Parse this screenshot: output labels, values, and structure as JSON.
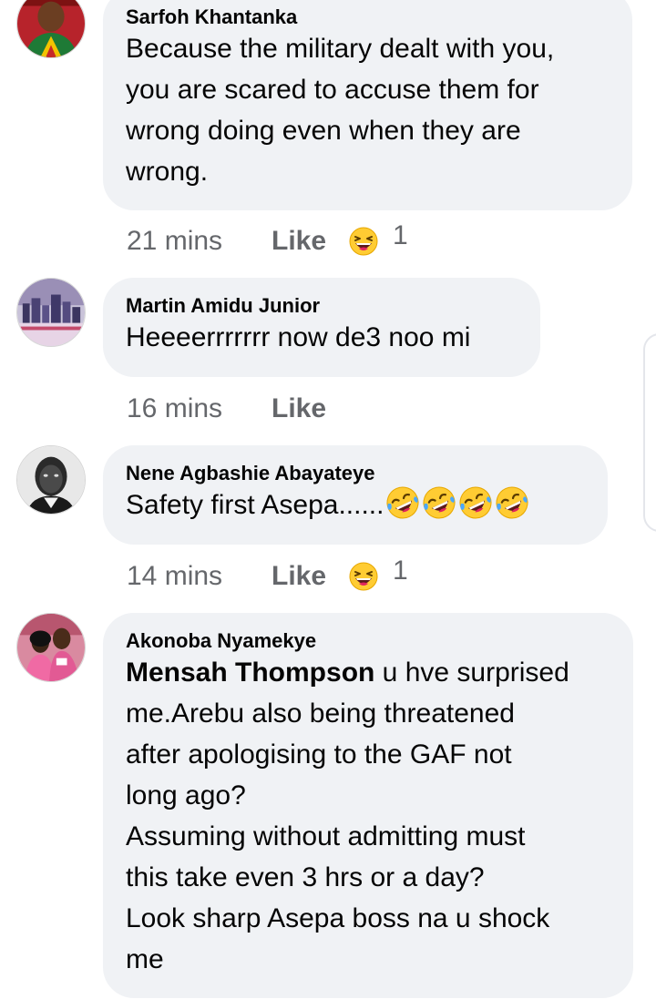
{
  "comments": [
    {
      "author": "Sarfoh Khantanka",
      "lines": [
        "Because the military dealt with you,",
        "you are scared to accuse them for",
        "wrong doing even when they are",
        "wrong."
      ],
      "time": "21 mins",
      "like_label": "Like",
      "reaction_icon": "laughing-face",
      "reaction_count": "1"
    },
    {
      "author": "Martin Amidu Junior",
      "lines": [
        "Heeeerrrrrrr now de3 noo mi"
      ],
      "time": "16 mins",
      "like_label": "Like"
    },
    {
      "author": "Nene Agbashie Abayateye",
      "lines": [
        "Safety first Asepa......"
      ],
      "inline_emoji": [
        "rolling-on-floor-laughing",
        "rolling-on-floor-laughing",
        "rolling-on-floor-laughing",
        "rolling-on-floor-laughing"
      ],
      "time": "14 mins",
      "like_label": "Like",
      "reaction_icon": "laughing-face",
      "reaction_count": "1"
    },
    {
      "author": "Akonoba Nyamekye",
      "mention": "Mensah Thompson",
      "first_line_rest": " u hve surprised",
      "lines": [
        "me.Arebu also being threatened",
        "after apologising to the GAF not",
        "long ago?",
        "Assuming without admitting must",
        "this take even 3 hrs or a day?",
        "Look sharp Asepa boss na u shock",
        "me"
      ]
    }
  ],
  "colors": {
    "bubble": "#f0f2f5",
    "meta_text": "#65676b",
    "emoji_yellow": "#ffcc33",
    "emoji_mouth": "#e0245e"
  }
}
